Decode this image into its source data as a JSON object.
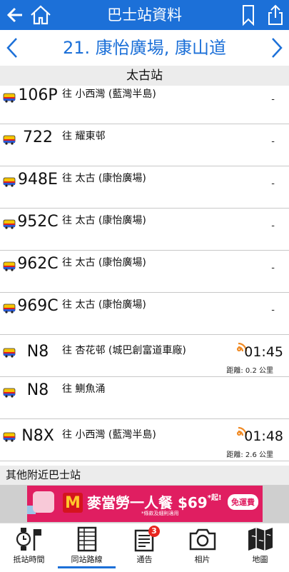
{
  "header": {
    "title": "巴士站資料",
    "back_icon": "arrow-left-icon",
    "home_icon": "home-icon",
    "bookmark_icon": "bookmark-icon",
    "share_icon": "share-icon"
  },
  "stop": {
    "name": "21. 康怡廣場, 康山道",
    "prev_icon": "chevron-left-icon",
    "next_icon": "chevron-right-icon"
  },
  "section_top": "太古站",
  "routes": [
    {
      "route": "106P",
      "dest": "往  小西灣 (藍灣半島)",
      "eta": "",
      "dash": "-",
      "distance": "",
      "live": false
    },
    {
      "route": "722",
      "dest": "往  耀東邨",
      "eta": "",
      "dash": "-",
      "distance": "",
      "live": false
    },
    {
      "route": "948E",
      "dest": "往  太古 (康怡廣場)",
      "eta": "",
      "dash": "-",
      "distance": "",
      "live": false
    },
    {
      "route": "952C",
      "dest": "往  太古 (康怡廣場)",
      "eta": "",
      "dash": "-",
      "distance": "",
      "live": false
    },
    {
      "route": "962C",
      "dest": "往  太古 (康怡廣場)",
      "eta": "",
      "dash": "-",
      "distance": "",
      "live": false
    },
    {
      "route": "969C",
      "dest": "往  太古 (康怡廣場)",
      "eta": "",
      "dash": "-",
      "distance": "",
      "live": false
    },
    {
      "route": "N8",
      "dest": "往  杏花邨 (城巴創富道車廠)",
      "eta": "01:45",
      "dash": "",
      "distance": "距離: 0.2 公里",
      "live": true
    },
    {
      "route": "N8",
      "dest": "往  鰂魚涌",
      "eta": "",
      "dash": "",
      "distance": "",
      "live": false
    },
    {
      "route": "N8X",
      "dest": "往  小西灣 (藍灣半島)",
      "eta": "01:48",
      "dash": "",
      "distance": "距離: 2.6 公里",
      "live": true
    }
  ],
  "section_other": "其他附近巴士站",
  "ad": {
    "text": "麥當勞一人餐 $69",
    "sup": "*起!",
    "badge": "免運費",
    "fine": "*條款及細則適用"
  },
  "tabs": [
    {
      "label": "抵站時間",
      "icon": "watch-flag-icon"
    },
    {
      "label": "同站路線",
      "icon": "table-icon"
    },
    {
      "label": "通告",
      "icon": "notice-icon",
      "badge": "3"
    },
    {
      "label": "相片",
      "icon": "camera-icon"
    },
    {
      "label": "地圖",
      "icon": "map-icon"
    }
  ],
  "colors": {
    "accent": "#1c70d8",
    "section_bg": "#ececec",
    "live_orange": "#f08a24",
    "badge_red": "#e8261f"
  }
}
